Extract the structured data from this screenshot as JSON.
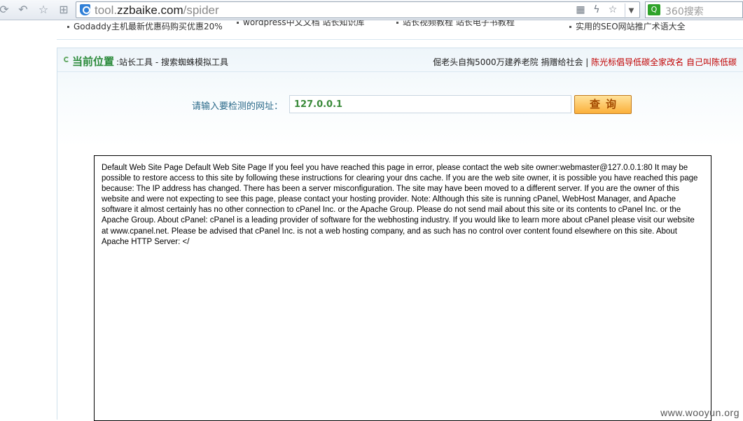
{
  "browser": {
    "url_prefix": "tool.",
    "url_domain": "zzbaike.com",
    "url_path": "/spider",
    "search_placeholder": "360搜索",
    "search_logo": "Q"
  },
  "top_links": [
    "Godaddy主机最新优惠码购买优惠20%",
    "wordpress中文文档 站长知识库",
    "站长视频教程 站长电子书教程",
    "实用的SEO网站推广术语大全"
  ],
  "breadcrumb": {
    "heading": "当前位置",
    "path": ":站长工具 - 搜索蜘蛛模拟工具",
    "ad_normal": "倔老头自掏5000万建养老院 捐赠给社会 | ",
    "ad_red": "陈光标倡导低碳全家改名 自己叫陈低碳"
  },
  "query": {
    "label": "请输入要检测的网址：",
    "value": "127.0.0.1",
    "button_label": "查询"
  },
  "result": {
    "text": "Default Web Site Page Default Web Site Page If you feel you have reached this page in error, please contact the web site owner:webmaster@127.0.0.1:80 It may be possible to restore access to this site by following these instructions for clearing your dns cache. If you are the web site owner, it is possible you have reached this page because: The IP address has changed. There has been a server misconfiguration. The site may have been moved to a different server. If you are the owner of this website and were not expecting to see this page, please contact your hosting provider. Note: Although this site is running cPanel, WebHost Manager, and Apache software it almost certainly has no other connection to cPanel Inc. or the Apache Group. Please do not send mail about this site or its contents to cPanel Inc. or the Apache Group. About cPanel: cPanel is a leading provider of software for the webhosting industry. If you would like to learn more about cPanel please visit our website at www.cpanel.net. Please be advised that cPanel Inc. is not a web hosting company, and as such has no control over content found elsewhere on this site. About Apache HTTP Server: </"
  },
  "watermark": "www.wooyun.org"
}
